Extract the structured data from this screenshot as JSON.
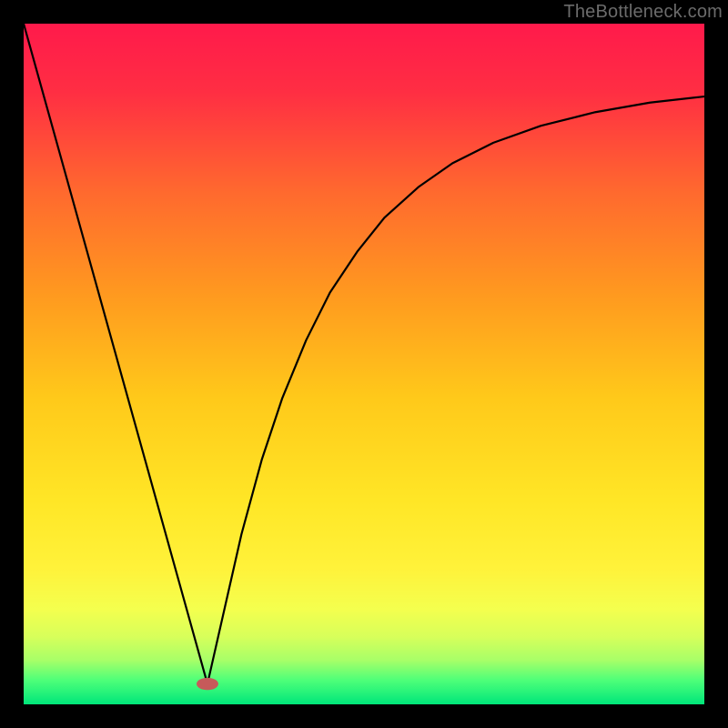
{
  "watermark": "TheBottleneck.com",
  "chart_data": {
    "type": "line",
    "title": "",
    "xlabel": "",
    "ylabel": "",
    "xlim": [
      0,
      100
    ],
    "ylim": [
      0,
      100
    ],
    "grid": false,
    "legend": false,
    "background": {
      "type": "vertical-gradient",
      "stops": [
        {
          "offset": 0.0,
          "color": "#ff1a4b"
        },
        {
          "offset": 0.1,
          "color": "#ff2e43"
        },
        {
          "offset": 0.25,
          "color": "#ff6a2e"
        },
        {
          "offset": 0.4,
          "color": "#ff9a1f"
        },
        {
          "offset": 0.55,
          "color": "#ffc91a"
        },
        {
          "offset": 0.7,
          "color": "#ffe626"
        },
        {
          "offset": 0.8,
          "color": "#fff23a"
        },
        {
          "offset": 0.86,
          "color": "#f4ff4e"
        },
        {
          "offset": 0.9,
          "color": "#d8ff5a"
        },
        {
          "offset": 0.935,
          "color": "#a8ff68"
        },
        {
          "offset": 0.965,
          "color": "#4dff79"
        },
        {
          "offset": 1.0,
          "color": "#00e67a"
        }
      ]
    },
    "series": [
      {
        "name": "left-descent",
        "color": "#000000",
        "width": 2.2,
        "x": [
          0.0,
          27.0
        ],
        "y": [
          100.0,
          3.0
        ]
      },
      {
        "name": "right-ascent",
        "color": "#000000",
        "width": 2.2,
        "x": [
          27.0,
          29.5,
          32.0,
          35.0,
          38.0,
          41.5,
          45.0,
          49.0,
          53.0,
          58.0,
          63.0,
          69.0,
          76.0,
          84.0,
          92.0,
          100.0
        ],
        "y": [
          3.0,
          14.0,
          25.0,
          36.0,
          45.0,
          53.5,
          60.5,
          66.5,
          71.5,
          76.0,
          79.5,
          82.5,
          85.0,
          87.0,
          88.4,
          89.3
        ]
      }
    ],
    "marker": {
      "name": "optimum",
      "x": 27.0,
      "y": 3.0,
      "rx": 1.6,
      "ry": 0.9,
      "fill": "#c65a5a"
    }
  }
}
